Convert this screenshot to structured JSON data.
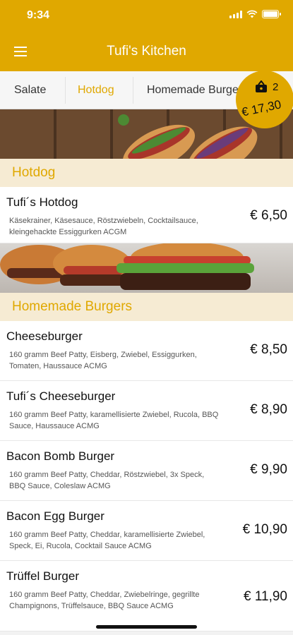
{
  "status": {
    "time": "9:34"
  },
  "header": {
    "title": "Tufi's Kitchen"
  },
  "tabs": [
    {
      "label": "Salate"
    },
    {
      "label": "Hotdog"
    },
    {
      "label": "Homemade Burgers"
    }
  ],
  "cart": {
    "count": "2",
    "total": "€ 17,30"
  },
  "sections": {
    "hotdog": {
      "title": "Hotdog"
    },
    "burgers": {
      "title": "Homemade Burgers"
    }
  },
  "items": [
    {
      "name": "Tufi´s Hotdog",
      "description": "Käsekrainer, Käsesauce, Röstzwiebeln, Cocktailsauce, kleingehackte Essiggurken ACGM",
      "price": "€ 6,50"
    },
    {
      "name": "Cheeseburger",
      "description": "160 gramm Beef Patty, Eisberg, Zwiebel, Essiggurken, Tomaten, Haussauce ACMG",
      "price": "€ 8,50"
    },
    {
      "name": "Tufi´s Cheeseburger",
      "description": "160 gramm Beef Patty, karamellisierte Zwiebel, Rucola, BBQ Sauce, Haussauce ACMG",
      "price": "€ 8,90"
    },
    {
      "name": "Bacon Bomb Burger",
      "description": "160 gramm Beef Patty, Cheddar, Röstzwiebel, 3x Speck, BBQ Sauce, Coleslaw ACMG",
      "price": "€ 9,90"
    },
    {
      "name": "Bacon Egg Burger",
      "description": "160 gramm Beef Patty, Cheddar, karamellisierte Zwiebel, Speck, Ei, Rucola, Cocktail Sauce ACMG",
      "price": "€ 10,90"
    },
    {
      "name": "Trüffel Burger",
      "description": "160 gramm Beef Patty, Cheddar, Zwiebelringe, gegrillte Champignons, Trüffelsauce, BBQ Sauce ACMG",
      "price": "€ 11,90"
    }
  ],
  "colors": {
    "accent": "#e0a800",
    "section_bg": "#f6ebd3"
  }
}
